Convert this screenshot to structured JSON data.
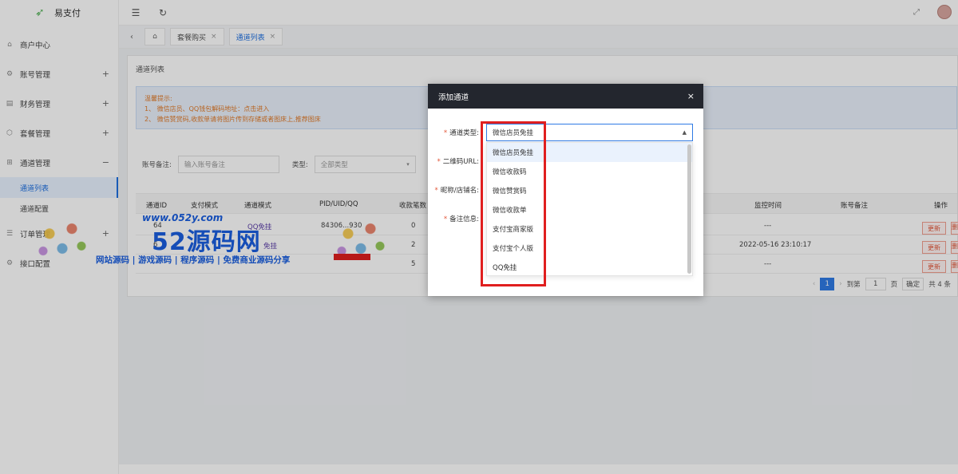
{
  "app": {
    "name": "易支付"
  },
  "sidebar": {
    "items": [
      {
        "label": "商户中心",
        "icon": "home-icon",
        "expand": ""
      },
      {
        "label": "账号管理",
        "icon": "gear-icon",
        "expand": "+"
      },
      {
        "label": "财务管理",
        "icon": "finance-icon",
        "expand": "+"
      },
      {
        "label": "套餐管理",
        "icon": "package-icon",
        "expand": "+"
      },
      {
        "label": "通道管理",
        "icon": "channel-icon",
        "expand": "−"
      },
      {
        "label": "订单管理",
        "icon": "order-icon",
        "expand": "+"
      },
      {
        "label": "接口配置",
        "icon": "api-icon",
        "expand": ""
      }
    ],
    "subitems": [
      {
        "label": "通道列表",
        "active": true
      },
      {
        "label": "通道配置",
        "active": false
      }
    ]
  },
  "tabs": [
    {
      "label": "套餐购买",
      "active": false
    },
    {
      "label": "通道列表",
      "active": true
    }
  ],
  "page": {
    "title": "通道列表",
    "tips": {
      "title": "温馨提示:",
      "line1": "1、 微信店员、QQ钱包解码地址：点击进入",
      "line2": "2、 微信赞赏码,收款单请将图片传到存储或者图床上,推荐图床"
    },
    "filters": {
      "account_label": "账号备注:",
      "account_placeholder": "输入账号备注",
      "type_label": "类型:",
      "type_value": "全部类型"
    },
    "table": {
      "columns": [
        "通道ID",
        "支付模式",
        "通道模式",
        "PID/UID/QQ",
        "收款笔数",
        "监控时间",
        "账号备注",
        "操作"
      ],
      "rows": [
        {
          "id": "64",
          "pid": "84306...930",
          "count": "0",
          "monitor": "---",
          "mode": "QQ免挂"
        },
        {
          "id": "6",
          "pid": "",
          "count": "2",
          "monitor": "2022-05-16 23:10:17",
          "mode": "免挂"
        },
        {
          "id": "",
          "pid": "",
          "count": "5",
          "monitor": "---",
          "mode": ""
        }
      ],
      "update_label": "更新",
      "delete_label": "删"
    },
    "pager": {
      "current": "1",
      "goto_label": "到第",
      "goto_value": "1",
      "page_unit": "页",
      "confirm": "确定",
      "total": "共 4 条"
    }
  },
  "modal": {
    "title": "添加通道",
    "close": "×",
    "fields": {
      "type_label": "通道类型:",
      "qr_label": "二维码URL:",
      "nick_label": "昵称/店铺名:",
      "remark_label": "备注信息:"
    },
    "select_value": "微信店员免挂",
    "options": [
      "微信店员免挂",
      "微信收款码",
      "微信赞赏码",
      "微信收款单",
      "支付宝商家版",
      "支付宝个人版",
      "QQ免挂"
    ],
    "highlighted_option": "微信店员免挂"
  },
  "watermark": {
    "url": "www.052y.com",
    "big": "52源码网",
    "line": "网站源码 | 游戏源码 | 程序源码 | 免费商业源码分享"
  }
}
